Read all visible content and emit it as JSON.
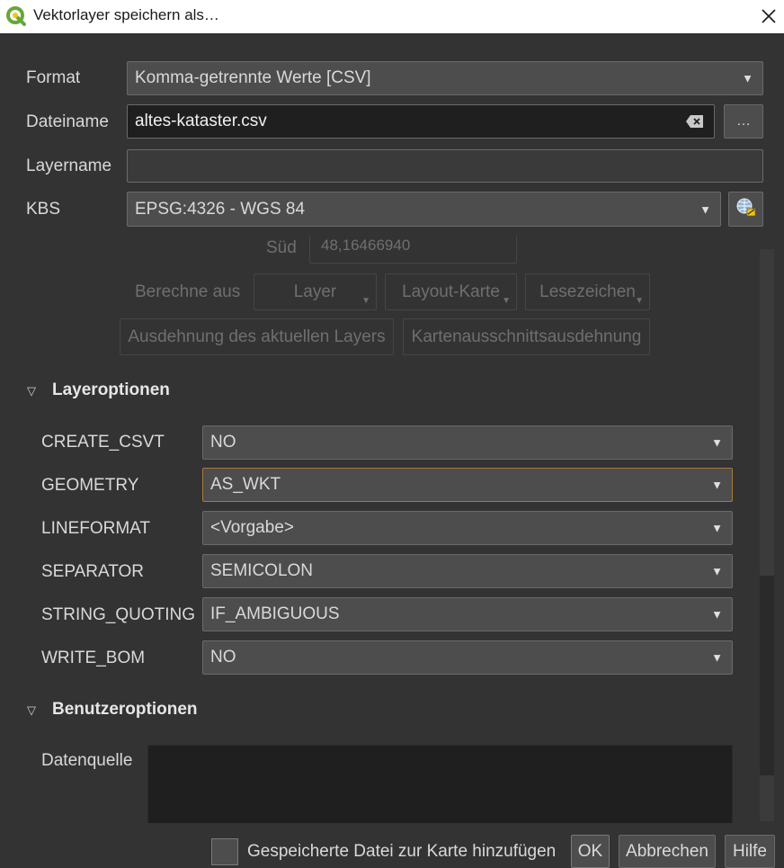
{
  "window": {
    "title": "Vektorlayer speichern als…",
    "app_icon": "qgis-logo-icon",
    "close_icon": "close-icon"
  },
  "form": {
    "format_label": "Format",
    "format_value": "Komma-getrennte Werte [CSV]",
    "filename_label": "Dateiname",
    "filename_value": "altes-kataster.csv",
    "browse_label": "…",
    "layername_label": "Layername",
    "layername_value": "",
    "crs_label": "KBS",
    "crs_value": "EPSG:4326 - WGS 84"
  },
  "extent": {
    "south_label": "Süd",
    "south_value": "48,16466940",
    "compute_from_label": "Berechne aus",
    "layer_button": "Layer",
    "layout_map_button": "Layout-Karte",
    "bookmarks_button": "Lesezeichen",
    "current_layer_extent_button": "Ausdehnung des aktuellen Layers",
    "map_canvas_extent_button": "Kartenausschnittsausdehnung"
  },
  "layer_options": {
    "title": "Layeroptionen",
    "items": [
      {
        "name": "CREATE_CSVT",
        "value": "NO"
      },
      {
        "name": "GEOMETRY",
        "value": "AS_WKT"
      },
      {
        "name": "LINEFORMAT",
        "value": "<Vorgabe>"
      },
      {
        "name": "SEPARATOR",
        "value": "SEMICOLON"
      },
      {
        "name": "STRING_QUOTING",
        "value": "IF_AMBIGUOUS"
      },
      {
        "name": "WRITE_BOM",
        "value": "NO"
      }
    ]
  },
  "custom_options": {
    "title": "Benutzeroptionen",
    "datasource_label": "Datenquelle",
    "datasource_value": ""
  },
  "footer": {
    "add_to_map_label": "Gespeicherte Datei zur Karte hinzufügen",
    "add_to_map_checked": false,
    "ok": "OK",
    "cancel": "Abbrechen",
    "help": "Hilfe"
  },
  "colors": {
    "background": "#333333",
    "field_dark": "#1f1f1f",
    "combo": "#4d4d4d",
    "focus_border": "#a8783a",
    "text": "#d9d9d9"
  }
}
